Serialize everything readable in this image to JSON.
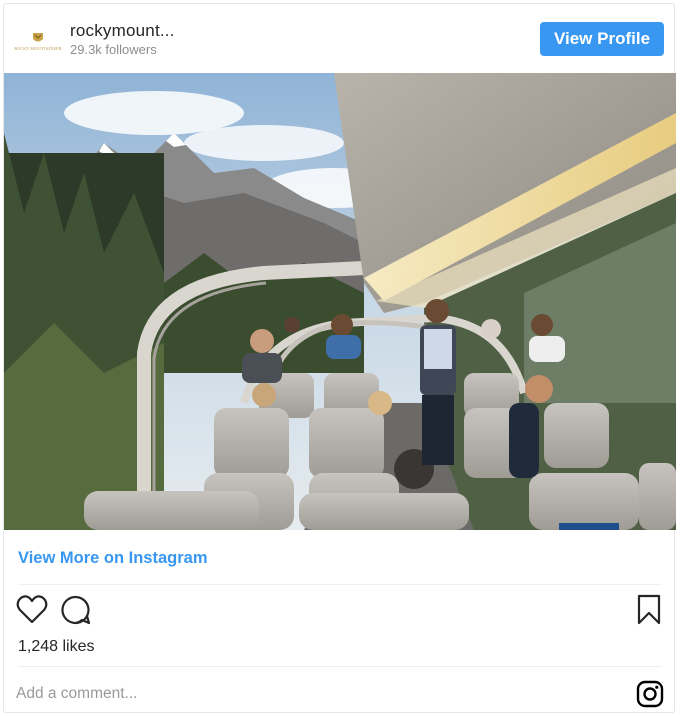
{
  "header": {
    "username": "rockymount...",
    "followers": "29.3k followers",
    "avatar_text": "ROCKY MOUNTAINEER",
    "view_profile_label": "View Profile"
  },
  "post": {
    "image_icon": "photo-train-dome-car",
    "view_more_label": "View More on Instagram",
    "likes": "1,248 likes"
  },
  "actions": {
    "like_icon": "heart-icon",
    "comment_icon": "comment-icon",
    "save_icon": "bookmark-icon"
  },
  "comment": {
    "placeholder": "Add a comment..."
  },
  "colors": {
    "accent": "#3897f0",
    "text": "#262626",
    "muted": "#8e8e8e",
    "brand_gold": "#b8963e"
  }
}
